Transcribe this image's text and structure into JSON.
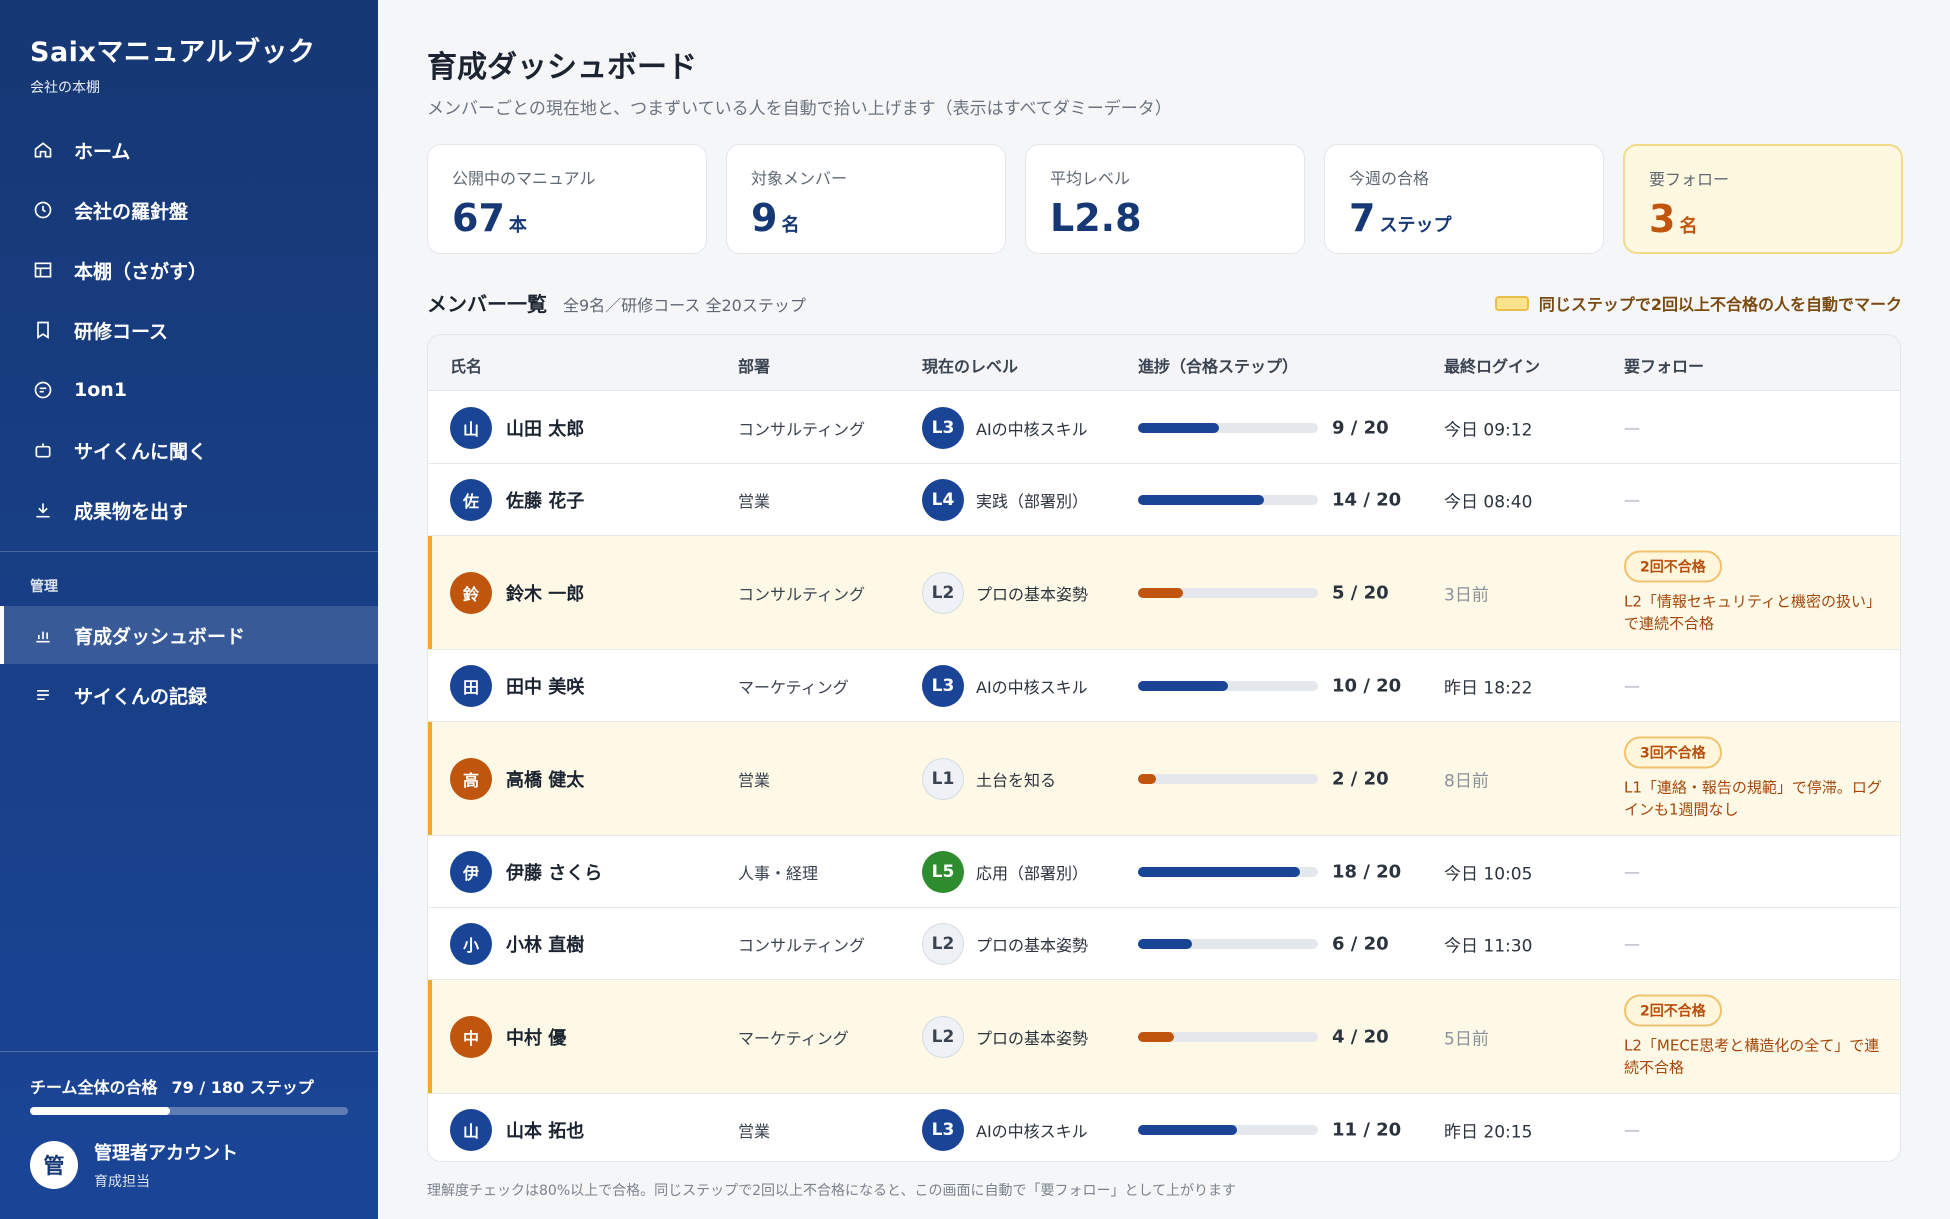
{
  "app": {
    "title": "Saixマニュアルブック",
    "subtitle": "会社の本棚"
  },
  "sidebar": {
    "items": [
      {
        "label": "ホーム",
        "icon": "home-icon"
      },
      {
        "label": "会社の羅針盤",
        "icon": "compass-icon"
      },
      {
        "label": "本棚（さがす）",
        "icon": "bookshelf-icon"
      },
      {
        "label": "研修コース",
        "icon": "bookmark-icon"
      },
      {
        "label": "1on1",
        "icon": "chat-icon"
      },
      {
        "label": "サイくんに聞く",
        "icon": "bot-icon"
      },
      {
        "label": "成果物を出す",
        "icon": "download-icon"
      }
    ],
    "section_label": "管理",
    "admin_items": [
      {
        "label": "育成ダッシュボード",
        "icon": "bar-chart-icon",
        "active": true
      },
      {
        "label": "サイくんの記録",
        "icon": "list-icon",
        "active": false
      }
    ],
    "team_progress": {
      "label": "チーム全体の合格",
      "value": "79 / 180 ステップ",
      "fraction": 0.439
    },
    "account": {
      "avatar": "管",
      "name": "管理者アカウント",
      "role": "育成担当"
    }
  },
  "page": {
    "title": "育成ダッシュボード",
    "subtitle": "メンバーごとの現在地と、つまずいている人を自動で拾い上げます（表示はすべてダミーデータ）"
  },
  "stats": [
    {
      "label": "公開中のマニュアル",
      "value": "67",
      "unit": "本"
    },
    {
      "label": "対象メンバー",
      "value": "9",
      "unit": "名"
    },
    {
      "label": "平均レベル",
      "value": "L2.8",
      "unit": ""
    },
    {
      "label": "今週の合格",
      "value": "7",
      "unit": "ステップ"
    },
    {
      "label": "要フォロー",
      "value": "3",
      "unit": "名"
    }
  ],
  "members": {
    "title": "メンバー一覧",
    "subtitle": "全9名／研修コース 全20ステップ",
    "legend": "同じステップで2回以上不合格の人を自動でマーク",
    "columns": [
      "氏名",
      "部署",
      "現在のレベル",
      "進捗（合格ステップ）",
      "最終ログイン",
      "要フォロー"
    ],
    "rows": [
      {
        "avatar": "山",
        "name": "山田 太郎",
        "dept": "コンサルティング",
        "level": "L3",
        "level_name": "AIの中核スキル",
        "progress": "9 / 20",
        "fraction": 0.45,
        "login": "今日 09:12",
        "follow": "—",
        "flag": false,
        "level_color": "#1a4597",
        "avatar_color": "#1a4597",
        "bar_color": "#1a4597"
      },
      {
        "avatar": "佐",
        "name": "佐藤 花子",
        "dept": "営業",
        "level": "L4",
        "level_name": "実践（部署別）",
        "progress": "14 / 20",
        "fraction": 0.7,
        "login": "今日 08:40",
        "follow": "—",
        "flag": false,
        "level_color": "#1a4597",
        "avatar_color": "#1a4597",
        "bar_color": "#1a4597"
      },
      {
        "avatar": "鈴",
        "name": "鈴木 一郎",
        "dept": "コンサルティング",
        "level": "L2",
        "level_name": "プロの基本姿勢",
        "progress": "5 / 20",
        "fraction": 0.25,
        "login": "3日前",
        "flag": true,
        "badge": "2回不合格",
        "note": "L2「情報セキュリティと機密の扱い」で連続不合格",
        "avatar_color": "#c0550d",
        "bar_color": "#c0550d"
      },
      {
        "avatar": "田",
        "name": "田中 美咲",
        "dept": "マーケティング",
        "level": "L3",
        "level_name": "AIの中核スキル",
        "progress": "10 / 20",
        "fraction": 0.5,
        "login": "昨日 18:22",
        "follow": "—",
        "flag": false,
        "level_color": "#1a4597",
        "avatar_color": "#1a4597",
        "bar_color": "#1a4597"
      },
      {
        "avatar": "高",
        "name": "高橋 健太",
        "dept": "営業",
        "level": "L1",
        "level_name": "土台を知る",
        "progress": "2 / 20",
        "fraction": 0.1,
        "login": "8日前",
        "flag": true,
        "badge": "3回不合格",
        "note": "L1「連絡・報告の規範」で停滞。ログインも1週間なし",
        "avatar_color": "#c0550d",
        "bar_color": "#c0550d"
      },
      {
        "avatar": "伊",
        "name": "伊藤 さくら",
        "dept": "人事・経理",
        "level": "L5",
        "level_name": "応用（部署別）",
        "progress": "18 / 20",
        "fraction": 0.9,
        "login": "今日 10:05",
        "follow": "—",
        "flag": false,
        "level_color": "#2e8b2e",
        "avatar_color": "#1a4597",
        "bar_color": "#1a4597"
      },
      {
        "avatar": "小",
        "name": "小林 直樹",
        "dept": "コンサルティング",
        "level": "L2",
        "level_name": "プロの基本姿勢",
        "progress": "6 / 20",
        "fraction": 0.3,
        "login": "今日 11:30",
        "follow": "—",
        "flag": false,
        "avatar_color": "#1a4597",
        "bar_color": "#1a4597"
      },
      {
        "avatar": "中",
        "name": "中村 優",
        "dept": "マーケティング",
        "level": "L2",
        "level_name": "プロの基本姿勢",
        "progress": "4 / 20",
        "fraction": 0.2,
        "login": "5日前",
        "flag": true,
        "badge": "2回不合格",
        "note": "L2「MECE思考と構造化の全て」で連続不合格",
        "avatar_color": "#c0550d",
        "bar_color": "#c0550d"
      },
      {
        "avatar": "山",
        "name": "山本 拓也",
        "dept": "営業",
        "level": "L3",
        "level_name": "AIの中核スキル",
        "progress": "11 / 20",
        "fraction": 0.55,
        "login": "昨日 20:15",
        "follow": "—",
        "flag": false,
        "level_color": "#1a4597",
        "avatar_color": "#1a4597",
        "bar_color": "#1a4597"
      }
    ]
  },
  "footer": "理解度チェックは80%以上で合格。同じステップで2回以上不合格になると、この画面に自動で「要フォロー」として上がります"
}
